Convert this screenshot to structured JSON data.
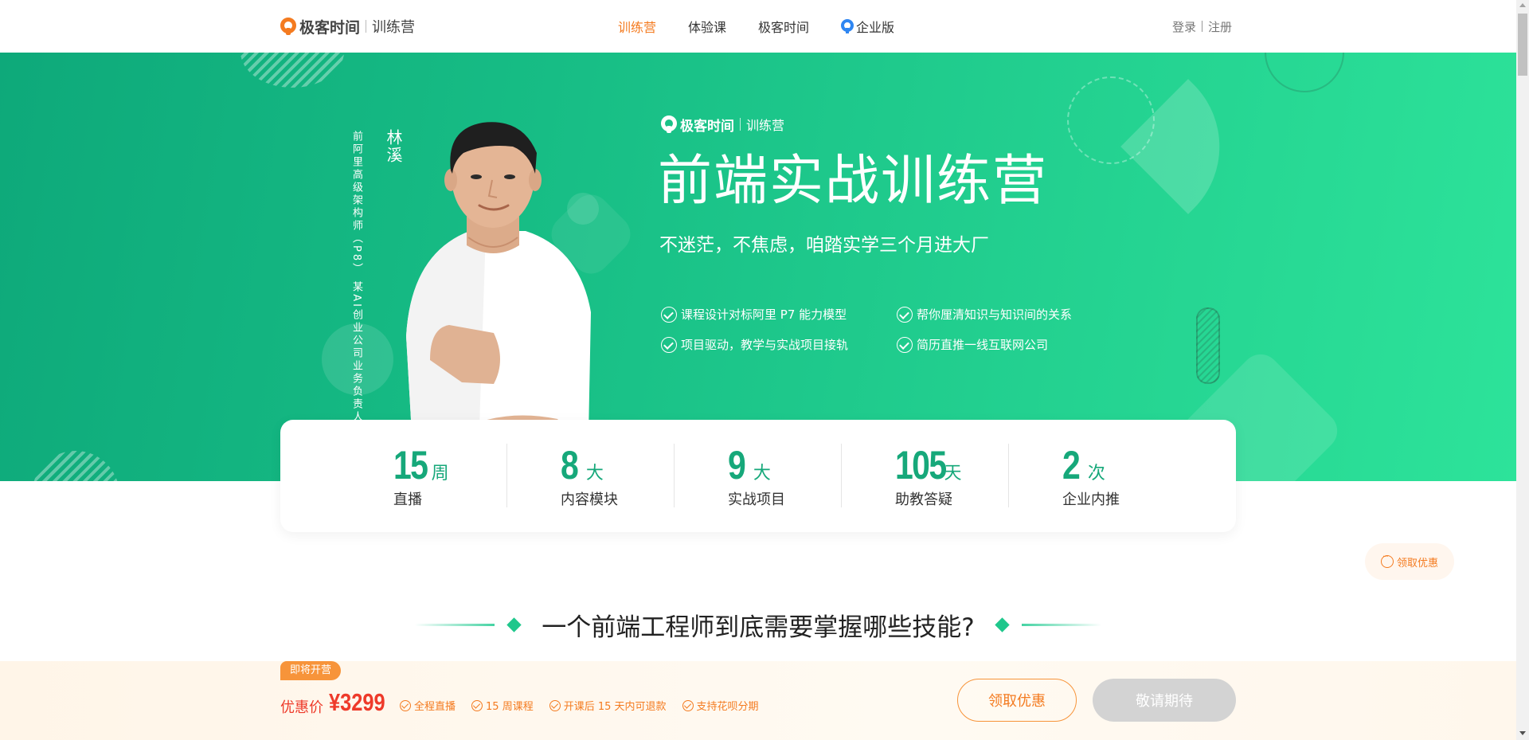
{
  "header": {
    "brand_name": "极客时间",
    "brand_sub": "训练营",
    "nav": [
      {
        "label": "训练营",
        "active": true
      },
      {
        "label": "体验课",
        "active": false
      },
      {
        "label": "极客时间",
        "active": false
      },
      {
        "label": "企业版",
        "active": false,
        "icon": "geektime-enterprise-icon"
      }
    ],
    "login": "登录",
    "register": "注册"
  },
  "hero": {
    "teacher_name": "林溪",
    "teacher_desc": [
      "前阿里高级架构师（P8）",
      "某AI创业公司业务负责人"
    ],
    "brand_name": "极客时间",
    "brand_sub": "训练营",
    "title": "前端实战训练营",
    "subtitle": "不迷茫，不焦虑，咱踏实学三个月进大厂",
    "features": [
      "课程设计对标阿里 P7 能力模型",
      "帮你厘清知识与知识间的关系",
      "项目驱动，教学与实战项目接轨",
      "简历直推一线互联网公司"
    ]
  },
  "stats": [
    {
      "num": "15",
      "unit": "周",
      "label": "直播"
    },
    {
      "num": "8",
      "unit": "大",
      "label": "内容模块"
    },
    {
      "num": "9",
      "unit": "大",
      "label": "实战项目"
    },
    {
      "num": "105",
      "unit": "天",
      "label": "助教答疑"
    },
    {
      "num": "2",
      "unit": "次",
      "label": "企业内推"
    }
  ],
  "float_coupon": "领取优惠",
  "section": {
    "title": "一个前端工程师到底需要掌握哪些技能?"
  },
  "bottom": {
    "badge": "即将开营",
    "price_label": "优惠价",
    "price": "¥3299",
    "perks": [
      "全程直播",
      "15 周课程",
      "开课后 15 天内可退款",
      "支持花呗分期"
    ],
    "coupon_button": "领取优惠",
    "wait_button": "敬请期待"
  },
  "colors": {
    "accent_orange": "#f47b20",
    "hero_green": "#22cf8f",
    "stat_green": "#16a87a",
    "price_red": "#ee3a2a"
  }
}
